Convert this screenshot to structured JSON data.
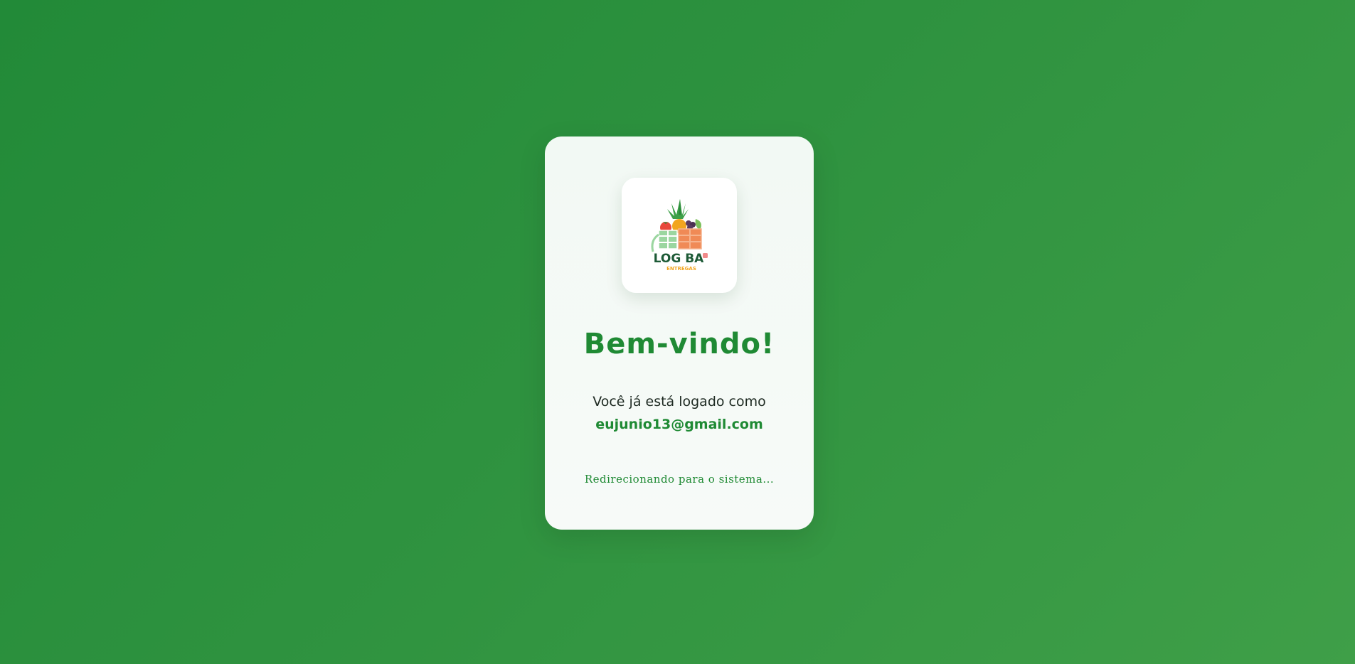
{
  "logo": {
    "icon": "log-ba-logo",
    "brand_text": "LOG BA",
    "sub_text": "ENTREGAS"
  },
  "welcome": {
    "title": "Bem-vindo!",
    "logged_text": "Você já está logado como",
    "email": "eujunio13@gmail.com",
    "redirect_text": "Redirecionando para o sistema..."
  },
  "colors": {
    "accent": "#1f8a34",
    "background_start": "#228a38",
    "background_end": "#3f9f48",
    "card": "#f4f9f5"
  }
}
